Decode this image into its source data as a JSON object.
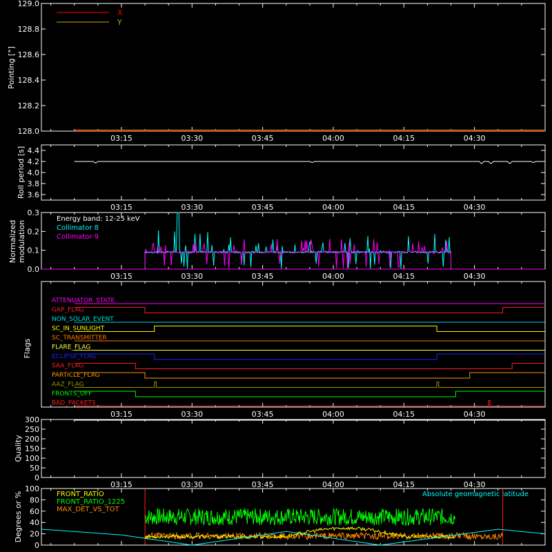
{
  "chart_data": [
    {
      "type": "line",
      "id": "pointing",
      "ylabel": "Pointing [°]",
      "ylim": [
        128.0,
        129.0
      ],
      "y_ticks": [
        128.0,
        128.2,
        128.4,
        128.6,
        128.8,
        129.0
      ],
      "y_tick_labels": [
        "128.0",
        "128.2",
        "128.4",
        "128.6",
        "128.8",
        "129.0"
      ],
      "x_tick_labels": [
        "03:15",
        "03:30",
        "03:45",
        "04:00",
        "04:15",
        "04:30"
      ],
      "legend": {
        "position": "top-left"
      },
      "series": [
        {
          "name": "X",
          "color": "#ff0000",
          "x_minutes": [
            0,
            100
          ],
          "y": [
            128.0,
            128.0
          ]
        },
        {
          "name": "Y",
          "color": "#c8a800",
          "x_minutes": [
            0,
            100
          ],
          "y": [
            128.0,
            128.0
          ]
        }
      ]
    },
    {
      "type": "line",
      "id": "roll",
      "ylabel": "Roll period [s]",
      "ylim": [
        3.5,
        4.5
      ],
      "y_ticks": [
        3.6,
        3.8,
        4.0,
        4.2,
        4.4
      ],
      "y_tick_labels": [
        "3.6",
        "3.8",
        "4.0",
        "4.2",
        "4.4"
      ],
      "x_tick_labels": [
        "03:15",
        "03:30",
        "03:45",
        "04:00",
        "04:15",
        "04:30"
      ],
      "series": [
        {
          "name": "",
          "color": "#ffffff",
          "x_minutes": [
            0,
            4,
            4.5,
            5,
            50,
            50.5,
            51,
            86,
            86.5,
            87,
            88,
            88.5,
            89,
            92,
            92.5,
            93,
            97,
            97.5,
            98,
            100
          ],
          "y": [
            4.2,
            4.2,
            4.17,
            4.2,
            4.2,
            4.18,
            4.2,
            4.2,
            4.16,
            4.2,
            4.2,
            4.16,
            4.2,
            4.2,
            4.16,
            4.2,
            4.2,
            4.18,
            4.2,
            4.2
          ]
        }
      ]
    },
    {
      "type": "line",
      "id": "modulation",
      "ylabel": "Normalized modulation",
      "ylim": [
        0.0,
        0.3
      ],
      "y_ticks": [
        0.0,
        0.1,
        0.2,
        0.3
      ],
      "y_tick_labels": [
        "0.0",
        "0.1",
        "0.2",
        "0.3"
      ],
      "x_tick_labels": [
        "03:15",
        "03:30",
        "03:45",
        "04:00",
        "04:15",
        "04:30"
      ],
      "annotation": "Energy band: 12-25 keV",
      "legend": {
        "position": "top-left"
      },
      "series": [
        {
          "name": "Collimator 8",
          "color": "#00ffff",
          "x_range_minutes": [
            15,
            80
          ],
          "baseline": 0.09,
          "spike_max": 0.3
        },
        {
          "name": "Collimator 9",
          "color": "#ff00ff",
          "x_range_minutes": [
            15,
            80
          ],
          "baseline": 0.09,
          "spike_max": 0.22
        }
      ]
    },
    {
      "type": "line",
      "id": "flags",
      "ylabel": "Flags",
      "x_tick_labels": [
        "03:15",
        "03:30",
        "03:45",
        "04:00",
        "04:15",
        "04:30"
      ],
      "flags": [
        {
          "name": "ATTENUATOR_STATE",
          "color": "#ff00ff",
          "segments": [
            [
              0,
              100,
              0
            ]
          ]
        },
        {
          "name": "GAP_FLAG",
          "color": "#ff2020",
          "segments": [
            [
              0,
              15,
              1
            ],
            [
              15,
              91,
              0
            ],
            [
              91,
              100,
              1
            ]
          ]
        },
        {
          "name": "NON_SOLAR_EVENT",
          "color": "#00dddd",
          "segments": [
            [
              0,
              100,
              0
            ]
          ]
        },
        {
          "name": "SC_IN_SUNLIGHT",
          "color": "#ffff00",
          "segments": [
            [
              0,
              17,
              0
            ],
            [
              17,
              77,
              1
            ],
            [
              77,
              100,
              0
            ]
          ]
        },
        {
          "name": "SC_TRANSMITTER",
          "color": "#ff7700",
          "segments": [
            [
              0,
              100,
              0
            ]
          ]
        },
        {
          "name": "FLARE_FLAG",
          "color": "#ffff40",
          "segments": [
            [
              0,
              100,
              0
            ]
          ]
        },
        {
          "name": "ECLIPSE_FLAG",
          "color": "#2020ff",
          "segments": [
            [
              0,
              17,
              1
            ],
            [
              17,
              77,
              0
            ],
            [
              77,
              100,
              1
            ]
          ]
        },
        {
          "name": "SAA_FLAG",
          "color": "#ff2020",
          "segments": [
            [
              0,
              13,
              1
            ],
            [
              13,
              93,
              0
            ],
            [
              93,
              100,
              1
            ]
          ]
        },
        {
          "name": "PARTICLE_FLAG",
          "color": "#ff9900",
          "segments": [
            [
              0,
              15,
              1
            ],
            [
              15,
              84,
              0
            ],
            [
              84,
              100,
              1
            ]
          ]
        },
        {
          "name": "AAZ_FLAG",
          "color": "#999900",
          "segments": [
            [
              0,
              17,
              0
            ],
            [
              17,
              17.4,
              1
            ],
            [
              17.4,
              77,
              0
            ],
            [
              77,
              77.4,
              1
            ],
            [
              77.4,
              100,
              0
            ]
          ]
        },
        {
          "name": "FRONTS_OFF",
          "color": "#00ff00",
          "segments": [
            [
              0,
              13,
              1
            ],
            [
              13,
              81,
              0
            ],
            [
              81,
              100,
              1
            ]
          ]
        },
        {
          "name": "BAD_PACKETS",
          "color": "#ff2020",
          "segments": [
            [
              0,
              88,
              0
            ],
            [
              88,
              88.3,
              1
            ],
            [
              88.3,
              100,
              0
            ]
          ]
        }
      ]
    },
    {
      "type": "line",
      "id": "quality",
      "ylabel": "Quality",
      "ylim": [
        0,
        300
      ],
      "y_ticks": [
        0,
        50,
        100,
        150,
        200,
        250,
        300
      ],
      "y_tick_labels": [
        "0",
        "50",
        "100",
        "150",
        "200",
        "250",
        "300"
      ],
      "x_tick_labels": [
        "03:15",
        "03:30",
        "03:45",
        "04:00",
        "04:15",
        "04:30"
      ],
      "series": [
        {
          "name": "",
          "color": "#ffffff",
          "x_minutes": [
            0,
            100
          ],
          "y": [
            300,
            300
          ]
        }
      ]
    },
    {
      "type": "line",
      "id": "ratios",
      "ylabel": "Degrees or %",
      "ylim": [
        0,
        100
      ],
      "y_ticks": [
        0,
        20,
        40,
        60,
        80,
        100
      ],
      "y_tick_labels": [
        "0",
        "20",
        "40",
        "60",
        "80",
        "100"
      ],
      "x_tick_labels": [
        "03:15",
        "03:30",
        "03:45",
        "04:00",
        "04:15",
        "04:30"
      ],
      "legend": {
        "position": "top-left"
      },
      "series": [
        {
          "name": "FRONT_RATIO",
          "color": "#ffff00",
          "x_range_minutes": [
            15,
            81
          ],
          "baseline": 15,
          "bump": [
            45,
            70,
            30
          ]
        },
        {
          "name": "FRONT_RATIO_1225",
          "color": "#00ff00",
          "x_range_minutes": [
            15,
            81
          ],
          "baseline": 50,
          "noise": 15
        },
        {
          "name": "MAX_DET_VS_TOT",
          "color": "#ff8800",
          "x_range_minutes": [
            15,
            91
          ],
          "baseline": 16,
          "noise": 6
        },
        {
          "name": "Absolute geomagnetic latitude",
          "color": "#00ffff",
          "x_minutes": [
            -7,
            10,
            25,
            45,
            65,
            90,
            100
          ],
          "y": [
            28,
            18,
            0,
            24,
            0,
            28,
            20
          ]
        }
      ],
      "gap_marker_color": "#ff2020",
      "gap_markers_minutes": [
        15,
        91
      ]
    }
  ]
}
